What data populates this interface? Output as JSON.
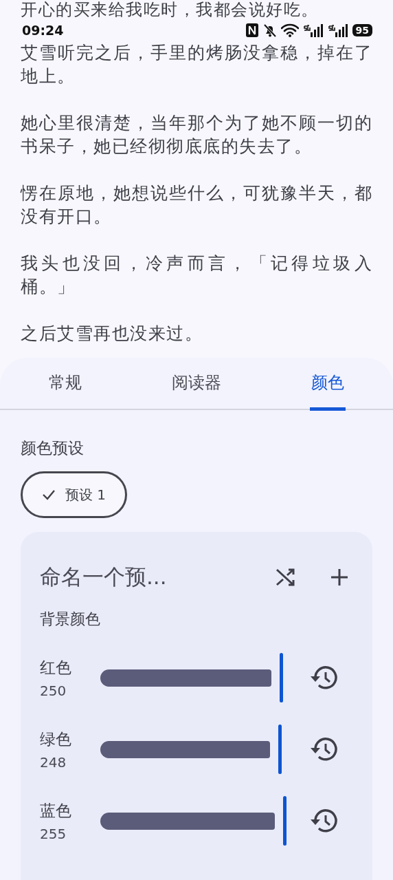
{
  "story": {
    "top_line": "开心的买来给我吃时，我都会说好吃。",
    "paragraphs": [
      "艾雪听完之后，手里的烤肠没拿稳，掉在了地上。",
      "她心里很清楚，当年那个为了她不顾一切的书呆子，她已经彻彻底底的失去了。",
      "愣在原地，她想说些什么，可犹豫半天，都没有开口。",
      "我头也没回，冷声而言，「记得垃圾入桶。」",
      "之后艾雪再也没来过。"
    ]
  },
  "status_bar": {
    "time": "09:24",
    "battery": "95"
  },
  "tabs": [
    {
      "label": "常规",
      "selected": false
    },
    {
      "label": "阅读器",
      "selected": false
    },
    {
      "label": "颜色",
      "selected": true
    }
  ],
  "color_presets": {
    "title": "颜色预设",
    "chips": [
      {
        "label": "预设 1",
        "selected": true
      }
    ]
  },
  "preset_card": {
    "name": "命名一个预...",
    "section": "背景颜色",
    "channels": [
      {
        "name": "红色",
        "value": "250",
        "level": 0.98
      },
      {
        "name": "绿色",
        "value": "248",
        "level": 0.973
      },
      {
        "name": "蓝色",
        "value": "255",
        "level": 1
      }
    ]
  }
}
